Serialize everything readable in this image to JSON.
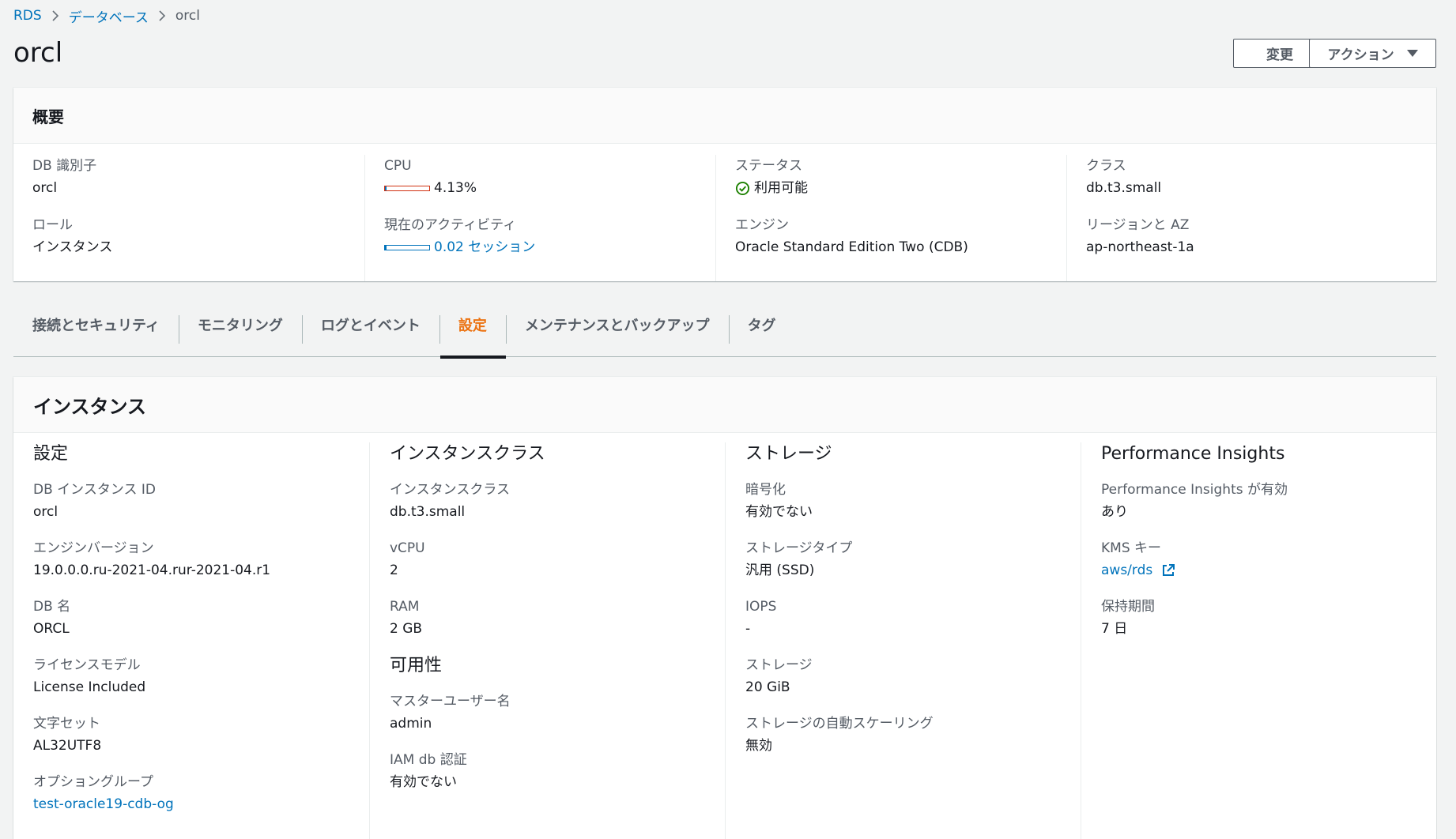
{
  "breadcrumb": {
    "root": "RDS",
    "databases": "データベース",
    "current": "orcl"
  },
  "page": {
    "title": "orcl",
    "modify_label": "変更",
    "actions_label": "アクション"
  },
  "summary": {
    "title": "概要",
    "db_id_label": "DB 識別子",
    "db_id": "orcl",
    "role_label": "ロール",
    "role": "インスタンス",
    "cpu_label": "CPU",
    "cpu_value": "4.13%",
    "cpu_percent": 4.13,
    "activity_label": "現在のアクティビティ",
    "activity_value": "0.02 セッション",
    "activity_fraction": 0.02,
    "status_label": "ステータス",
    "status_value": "利用可能",
    "engine_label": "エンジン",
    "engine_value": "Oracle Standard Edition Two (CDB)",
    "class_label": "クラス",
    "class_value": "db.t3.small",
    "region_label": "リージョンと AZ",
    "region_value": "ap-northeast-1a"
  },
  "tabs": [
    {
      "label": "接続とセキュリティ",
      "active": false
    },
    {
      "label": "モニタリング",
      "active": false
    },
    {
      "label": "ログとイベント",
      "active": false
    },
    {
      "label": "設定",
      "active": true
    },
    {
      "label": "メンテナンスとバックアップ",
      "active": false
    },
    {
      "label": "タグ",
      "active": false
    }
  ],
  "instance": {
    "title": "インスタンス",
    "settings": {
      "title": "設定",
      "instance_id_label": "DB インスタンス ID",
      "instance_id": "orcl",
      "engine_version_label": "エンジンバージョン",
      "engine_version": "19.0.0.0.ru-2021-04.rur-2021-04.r1",
      "db_name_label": "DB 名",
      "db_name": "ORCL",
      "license_label": "ライセンスモデル",
      "license": "License Included",
      "charset_label": "文字セット",
      "charset": "AL32UTF8",
      "option_group_label": "オプショングループ",
      "option_group": "test-oracle19-cdb-og"
    },
    "instance_class": {
      "title": "インスタンスクラス",
      "class_label": "インスタンスクラス",
      "class_value": "db.t3.small",
      "vcpu_label": "vCPU",
      "vcpu_value": "2",
      "ram_label": "RAM",
      "ram_value": "2 GB"
    },
    "availability": {
      "title": "可用性",
      "master_user_label": "マスターユーザー名",
      "master_user": "admin",
      "iam_label": "IAM db 認証",
      "iam_value": "有効でない"
    },
    "storage": {
      "title": "ストレージ",
      "encryption_label": "暗号化",
      "encryption_value": "有効でない",
      "type_label": "ストレージタイプ",
      "type_value": "汎用 (SSD)",
      "iops_label": "IOPS",
      "iops_value": "-",
      "storage_label": "ストレージ",
      "storage_value": "20 GiB",
      "autoscaling_label": "ストレージの自動スケーリング",
      "autoscaling_value": "無効"
    },
    "performance_insights": {
      "title": "Performance Insights",
      "enabled_label": "Performance Insights が有効",
      "enabled_value": "あり",
      "kms_label": "KMS キー",
      "kms_value": "aws/rds",
      "retention_label": "保持期間",
      "retention_value": "7 日"
    }
  }
}
